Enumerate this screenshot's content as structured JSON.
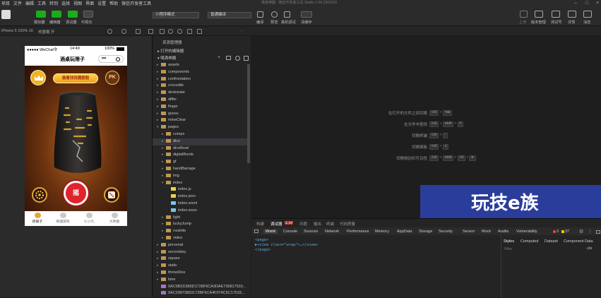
{
  "menu": [
    "项目",
    "文件",
    "编辑",
    "工具",
    "转到",
    "选择",
    "视图",
    "界面",
    "设置",
    "帮助",
    "微信开发者工具"
  ],
  "window_title": "噶滴神器 - 微信开发者工具 Stable 1.06.2303220",
  "toolbar": {
    "simulator_label": "模拟器",
    "editor_label": "编辑器",
    "debugger_label": "调试器",
    "visual_label": "可视化",
    "mode_select": "小程序模式",
    "compile_select": "普通编译",
    "compile_label": "编译",
    "preview_label": "预览",
    "real_debug_label": "真机调试",
    "clear_cache_label": "清缓存",
    "upload_label": "上传",
    "version_label": "版本管理",
    "test_label": "测试号",
    "details_label": "详情",
    "messages_label": "消息"
  },
  "subbar": {
    "device": "iPhone 5 100% 16",
    "hot_reload": "热重载 开"
  },
  "phone": {
    "carrier": "●●●●● WeChat令",
    "time": "14:49",
    "battery": "100%",
    "title": "酒桌玩筛子",
    "banner_button": "最看钱钱趣骰骰",
    "pk_label": "PK",
    "shake_label": "摇",
    "tabs": [
      "摇骰子",
      "喝酒游戏",
      "七小凡",
      "大转盘"
    ]
  },
  "explorer": {
    "title": "资源管理器",
    "open_editors": "打开的编辑器",
    "project": "噶滴神器",
    "tree": [
      {
        "name": "assets",
        "depth": 1,
        "type": "folder"
      },
      {
        "name": "components",
        "depth": 1,
        "type": "folder"
      },
      {
        "name": "confrontation",
        "depth": 1,
        "type": "folder"
      },
      {
        "name": "crocodile",
        "depth": 1,
        "type": "folder"
      },
      {
        "name": "deskmate",
        "depth": 1,
        "type": "folder"
      },
      {
        "name": "differ",
        "depth": 1,
        "type": "folder"
      },
      {
        "name": "finger",
        "depth": 1,
        "type": "folder"
      },
      {
        "name": "guess",
        "depth": 1,
        "type": "folder"
      },
      {
        "name": "mineClear",
        "depth": 1,
        "type": "folder"
      },
      {
        "name": "pages",
        "depth": 1,
        "type": "folder-open"
      },
      {
        "name": "comps",
        "depth": 2,
        "type": "folder"
      },
      {
        "name": "dice",
        "depth": 2,
        "type": "folder",
        "selected": true
      },
      {
        "name": "diceBowl",
        "depth": 2,
        "type": "folder"
      },
      {
        "name": "digitalBomb",
        "depth": 2,
        "type": "folder"
      },
      {
        "name": "gf",
        "depth": 2,
        "type": "folder"
      },
      {
        "name": "handBarrage",
        "depth": 2,
        "type": "folder"
      },
      {
        "name": "img",
        "depth": 2,
        "type": "folder"
      },
      {
        "name": "index",
        "depth": 2,
        "type": "folder-open"
      },
      {
        "name": "index.js",
        "depth": 3,
        "type": "js"
      },
      {
        "name": "index.json",
        "depth": 3,
        "type": "json"
      },
      {
        "name": "index.wxml",
        "depth": 3,
        "type": "wxml"
      },
      {
        "name": "index.wxss",
        "depth": 3,
        "type": "wxss"
      },
      {
        "name": "light",
        "depth": 2,
        "type": "folder"
      },
      {
        "name": "luckyJump",
        "depth": 2,
        "type": "folder"
      },
      {
        "name": "roulette",
        "depth": 2,
        "type": "folder"
      },
      {
        "name": "video",
        "depth": 2,
        "type": "folder"
      },
      {
        "name": "personal",
        "depth": 1,
        "type": "folder"
      },
      {
        "name": "secondary",
        "depth": 1,
        "type": "folder"
      },
      {
        "name": "square",
        "depth": 1,
        "type": "folder"
      },
      {
        "name": "static",
        "depth": 1,
        "type": "folder"
      },
      {
        "name": "throwDice",
        "depth": 1,
        "type": "folder"
      },
      {
        "name": "time",
        "depth": 1,
        "type": "folder"
      },
      {
        "name": "0AC5B2D385D1728F6CA3DAE736817533...",
        "depth": 1,
        "type": "img"
      },
      {
        "name": "0AC29873850172BF6CA4F074C5C17533...",
        "depth": 1,
        "type": "img"
      }
    ]
  },
  "editor_hints": [
    {
      "label": "在打开的文件之间切换",
      "keys": [
        "Ctrl",
        "+",
        "Tab"
      ]
    },
    {
      "label": "在文件中查找",
      "keys": [
        "Ctrl",
        "+",
        "Shift",
        "+",
        "F"
      ]
    },
    {
      "label": "切换终端",
      "keys": [
        "Ctrl",
        "+",
        "`"
      ]
    },
    {
      "label": "切换面板",
      "keys": [
        "Ctrl",
        "+",
        "J"
      ]
    },
    {
      "label": "切换侧边栏可见性",
      "keys": [
        "Ctrl",
        "+",
        "Shift",
        "+",
        "Alt",
        "+",
        "B"
      ]
    }
  ],
  "watermark_text": "玩技e族",
  "debugger": {
    "top_tabs": [
      "构建",
      "调试器",
      "问题",
      "输出",
      "终端",
      "代码质量"
    ],
    "debugger_badge": "1, 37",
    "dev_tabs": [
      "Wxml",
      "Console",
      "Sources",
      "Network",
      "Performance",
      "Memory",
      "AppData",
      "Storage",
      "Security",
      "Sensor",
      "Mock",
      "Audits",
      "Vulnerability"
    ],
    "error_count": "3",
    "warn_count": "37",
    "code_lines": [
      "<page>",
      "  ▶<view class=\"wrap\">…</view>",
      "</page>"
    ],
    "style_tabs": [
      "Styles",
      "Computed",
      "Dataset",
      "Component Data"
    ],
    "filter_placeholder": "Filter",
    "cls_label": ".cls"
  },
  "colors": {
    "accent": "#1aad19",
    "watermark_bg": "#2a3d9a",
    "shake_red": "#e0242b"
  }
}
